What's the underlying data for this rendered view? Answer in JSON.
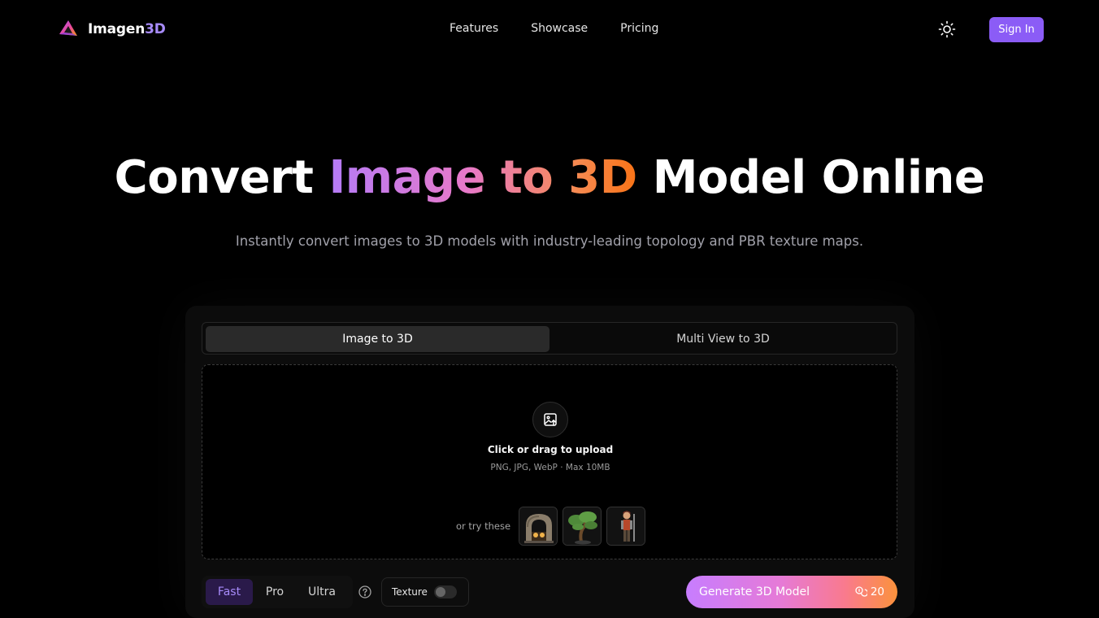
{
  "brand": {
    "name_part1": "Imagen",
    "name_part2": "3D"
  },
  "nav": {
    "links": [
      "Features",
      "Showcase",
      "Pricing"
    ],
    "sign_in": "Sign In"
  },
  "hero": {
    "title_pre": "Convert",
    "title_grad": "Image to 3D",
    "title_post": "Model Online",
    "subtitle": "Instantly convert images to 3D models with industry-leading topology and PBR texture maps."
  },
  "tabs": [
    "Image to 3D",
    "Multi View to 3D"
  ],
  "upload": {
    "title": "Click or drag to upload",
    "formats": "PNG, JPG, WebP · Max 10MB",
    "try_label": "or try these"
  },
  "samples": [
    "stone-arch-thumbnail",
    "bonsai-tree-thumbnail",
    "warrior-character-thumbnail"
  ],
  "quality": {
    "options": [
      "Fast",
      "Pro",
      "Ultra"
    ],
    "selected": "Fast"
  },
  "texture": {
    "label": "Texture",
    "enabled": false
  },
  "generate": {
    "label": "Generate 3D Model",
    "credits": "20"
  },
  "colors": {
    "accent": "#8b5cf6",
    "gradient_start": "#b47bf7",
    "gradient_end": "#f97316"
  }
}
